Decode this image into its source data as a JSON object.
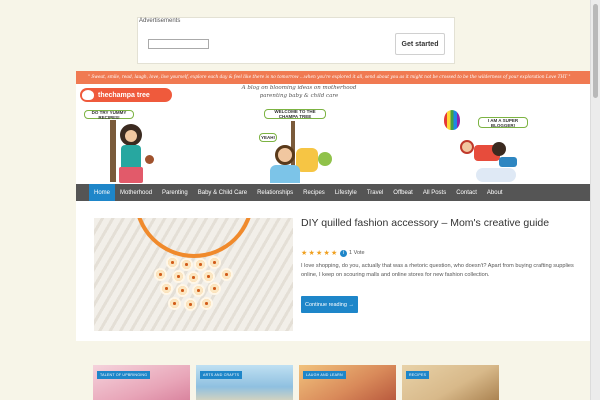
{
  "ad": {
    "label": "Advertisements",
    "button_label": "Get started"
  },
  "header": {
    "quote": "\" Sweat, smile, read, laugh, love, live yourself, explore each day & feel like there is no tomorrow ...when you're explored it all, send about you as it might not be crossed to be the wilderness of your exploration  Love THT \"",
    "logo_text": "thechampa tree",
    "tagline": "A blog on blooming ideas on motherhood parenting baby & child care",
    "sign_left": "DO TRY YUMMY RECIPES!",
    "sign_center": "WELCOME TO THE CHAMPA TREE",
    "sign_center_small": "YEAH!",
    "sign_right": "I AM A SUPER BLOGGER!"
  },
  "nav": {
    "items": [
      "Home",
      "Motherhood",
      "Parenting",
      "Baby & Child Care",
      "Relationships",
      "Recipes",
      "Lifestyle",
      "Travel",
      "Offbeat",
      "All Posts",
      "Contact",
      "About"
    ],
    "active": "Home"
  },
  "post": {
    "title": "DIY quilled fashion accessory – Mom's creative guide",
    "rating": 5,
    "votes": "1 Vote",
    "excerpt": "I love shopping, do you, actually that was a rhetoric question, who doesn't? Apart from buying crafting supplies online, I keep on scouring malls and online stores for new fashion collection.",
    "read_more": "Continue reading →"
  },
  "categories": [
    {
      "badge": "TALENT OF UPBRINGING",
      "color": "#e8a5b8"
    },
    {
      "badge": "ARTS AND CRAFTS",
      "color": "#8fc0e0"
    },
    {
      "badge": "LAUGH AND LEARN",
      "color": "#d98a5a"
    },
    {
      "badge": "RECIPES",
      "color": "#d8b98a"
    }
  ],
  "colors": {
    "accent": "#1e86c9",
    "nav_bg": "#555555",
    "quote_bar": "#f07a52",
    "page_bg": "#f7f5e8"
  }
}
